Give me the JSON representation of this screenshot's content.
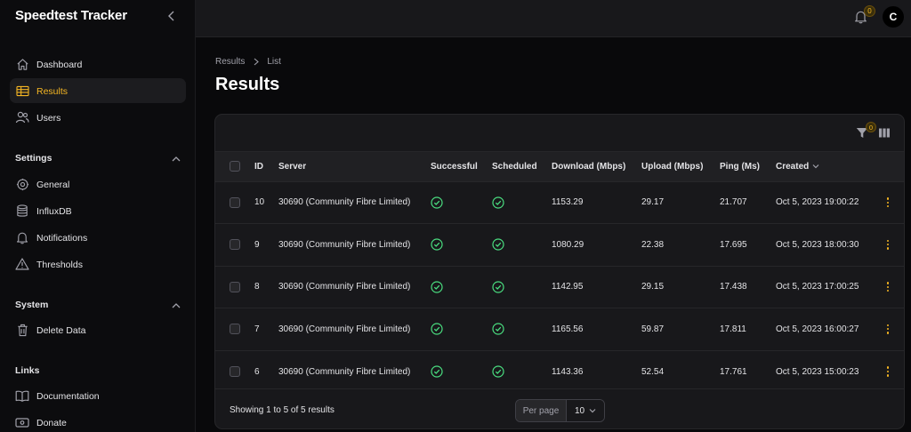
{
  "app": {
    "title": "Speedtest Tracker"
  },
  "sidebar": {
    "main": [
      {
        "label": "Dashboard",
        "icon": "home-icon"
      },
      {
        "label": "Results",
        "icon": "table-icon",
        "active": true
      },
      {
        "label": "Users",
        "icon": "users-icon"
      }
    ],
    "groups": [
      {
        "title": "Settings",
        "items": [
          {
            "label": "General",
            "icon": "cog-icon"
          },
          {
            "label": "InfluxDB",
            "icon": "database-icon"
          },
          {
            "label": "Notifications",
            "icon": "bell-icon"
          },
          {
            "label": "Thresholds",
            "icon": "warning-icon"
          }
        ]
      },
      {
        "title": "System",
        "items": [
          {
            "label": "Delete Data",
            "icon": "trash-icon"
          }
        ]
      },
      {
        "title": "Links",
        "items": [
          {
            "label": "Documentation",
            "icon": "book-icon"
          },
          {
            "label": "Donate",
            "icon": "donate-icon"
          }
        ]
      }
    ]
  },
  "topbar": {
    "notifications_count": "0",
    "avatar_initial": "C"
  },
  "breadcrumb": [
    "Results",
    "List"
  ],
  "page": {
    "title": "Results"
  },
  "toolbar": {
    "filter_count": "0"
  },
  "table": {
    "columns": [
      "ID",
      "Server",
      "Successful",
      "Scheduled",
      "Download (Mbps)",
      "Upload (Mbps)",
      "Ping (Ms)",
      "Created"
    ],
    "rows": [
      {
        "id": "10",
        "server": "30690 (Community Fibre Limited)",
        "successful": true,
        "scheduled": true,
        "download": "1153.29",
        "upload": "29.17",
        "ping": "21.707",
        "created": "Oct 5, 2023 19:00:22"
      },
      {
        "id": "9",
        "server": "30690 (Community Fibre Limited)",
        "successful": true,
        "scheduled": true,
        "download": "1080.29",
        "upload": "22.38",
        "ping": "17.695",
        "created": "Oct 5, 2023 18:00:30"
      },
      {
        "id": "8",
        "server": "30690 (Community Fibre Limited)",
        "successful": true,
        "scheduled": true,
        "download": "1142.95",
        "upload": "29.15",
        "ping": "17.438",
        "created": "Oct 5, 2023 17:00:25"
      },
      {
        "id": "7",
        "server": "30690 (Community Fibre Limited)",
        "successful": true,
        "scheduled": true,
        "download": "1165.56",
        "upload": "59.87",
        "ping": "17.811",
        "created": "Oct 5, 2023 16:00:27"
      },
      {
        "id": "6",
        "server": "30690 (Community Fibre Limited)",
        "successful": true,
        "scheduled": true,
        "download": "1143.36",
        "upload": "52.54",
        "ping": "17.761",
        "created": "Oct 5, 2023 15:00:23"
      }
    ]
  },
  "footer": {
    "showing": "Showing 1 to 5 of 5 results",
    "per_page_label": "Per page",
    "per_page_value": "10"
  },
  "colors": {
    "accent": "#f5b623",
    "success": "#4ade80"
  }
}
